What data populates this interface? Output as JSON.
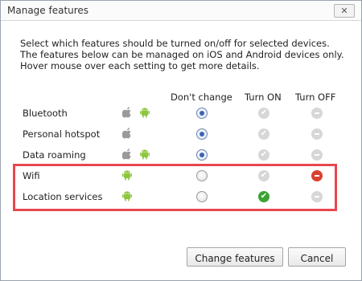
{
  "dialog": {
    "title": "Manage features",
    "close_glyph": "✕"
  },
  "description": {
    "line1": "Select which features should be turned on/off for selected devices.",
    "line2": "The features below can be managed on iOS and Android devices only.",
    "line3": "Hover mouse over each setting to get more details."
  },
  "columns": {
    "dont_change": "Don't change",
    "turn_on": "Turn ON",
    "turn_off": "Turn OFF"
  },
  "features": [
    {
      "label": "Bluetooth",
      "ios": true,
      "android": true,
      "selected": "dont_change"
    },
    {
      "label": "Personal hotspot",
      "ios": true,
      "android": false,
      "selected": "dont_change"
    },
    {
      "label": "Data roaming",
      "ios": true,
      "android": true,
      "selected": "dont_change"
    },
    {
      "label": "Wifi",
      "ios": false,
      "android": true,
      "selected": "turn_off"
    },
    {
      "label": "Location services",
      "ios": false,
      "android": true,
      "selected": "turn_on"
    }
  ],
  "buttons": {
    "change": "Change features",
    "cancel": "Cancel"
  },
  "colors": {
    "highlight": "#e8464e",
    "on": "#3aa335",
    "off": "#d9412e",
    "radio_selected": "#3a64b5"
  }
}
